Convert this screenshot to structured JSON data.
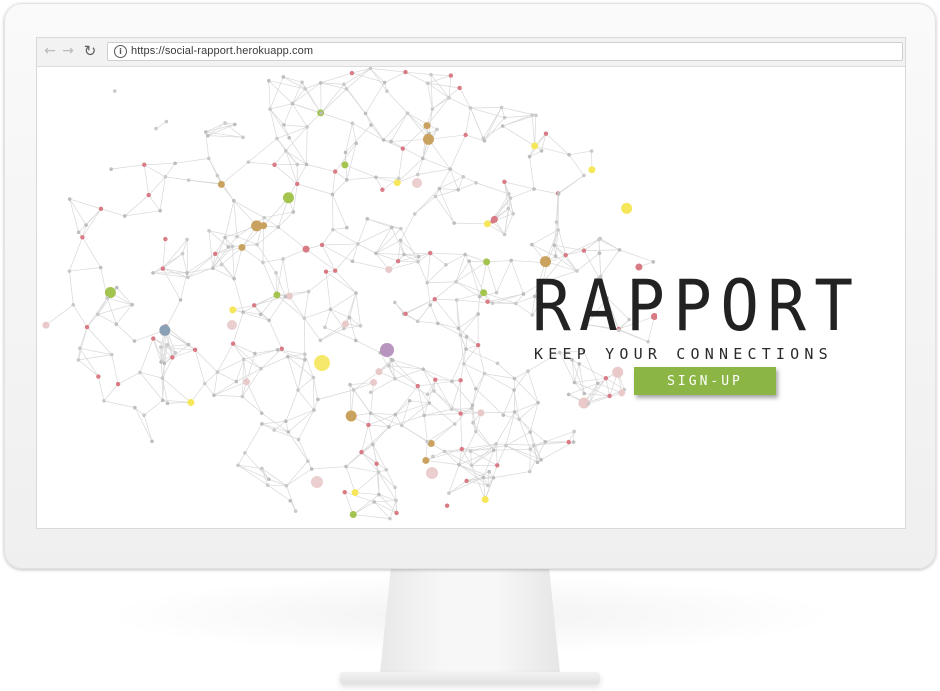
{
  "browser": {
    "url": "https://social-rapport.herokuapp.com",
    "back_icon": "←",
    "forward_icon": "→",
    "reload_icon": "↻",
    "info_icon": "i"
  },
  "hero": {
    "brand": "RAPPORT",
    "tagline": "KEEP YOUR CONNECTIONS",
    "signup_label": "SIGN-UP"
  },
  "colors": {
    "accent": "#8bb545",
    "text": "#222222",
    "node_palette": [
      "#c9c9c9",
      "#bdbdbd",
      "#d97b84",
      "#c9a25f",
      "#8aa0b4",
      "#a4c450",
      "#e9c9c9",
      "#f5e65a",
      "#b08ab8"
    ]
  }
}
